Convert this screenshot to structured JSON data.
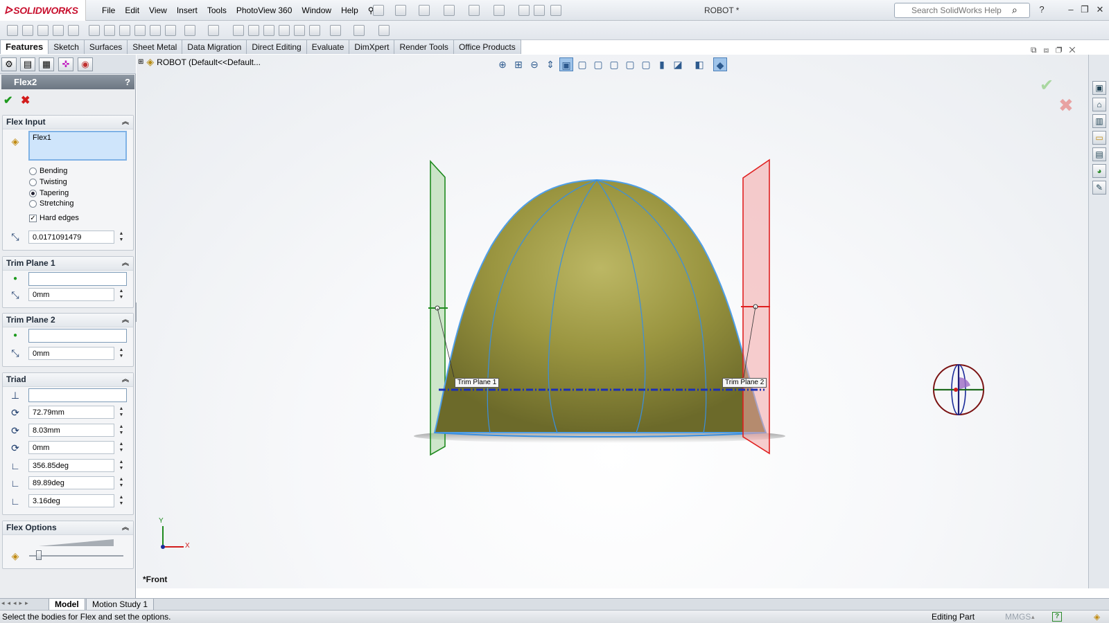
{
  "app": {
    "logo": "SOLIDWORKS",
    "doc_title": "ROBOT *"
  },
  "menu": [
    "File",
    "Edit",
    "View",
    "Insert",
    "Tools",
    "PhotoView 360",
    "Window",
    "Help"
  ],
  "search": {
    "placeholder": "Search SolidWorks Help"
  },
  "command_tabs": [
    "Features",
    "Sketch",
    "Surfaces",
    "Sheet Metal",
    "Data Migration",
    "Direct Editing",
    "Evaluate",
    "DimXpert",
    "Render Tools",
    "Office Products"
  ],
  "property_manager": {
    "title": "Flex2",
    "help": "?",
    "flex_input": {
      "heading": "Flex Input",
      "selection": "Flex1",
      "modes": [
        {
          "label": "Bending",
          "selected": false
        },
        {
          "label": "Twisting",
          "selected": false
        },
        {
          "label": "Tapering",
          "selected": true
        },
        {
          "label": "Stretching",
          "selected": false
        }
      ],
      "hard_edges_label": "Hard edges",
      "hard_edges_checked": true,
      "taper_factor": "0.0171091479"
    },
    "trim_plane_1": {
      "heading": "Trim Plane 1",
      "selection": "",
      "distance": "0mm"
    },
    "trim_plane_2": {
      "heading": "Trim Plane 2",
      "selection": "",
      "distance": "0mm"
    },
    "triad": {
      "heading": "Triad",
      "selection": "",
      "x": "72.79mm",
      "y": "8.03mm",
      "z": "0mm",
      "rot_x": "356.85deg",
      "rot_y": "89.89deg",
      "rot_z": "3.16deg"
    },
    "flex_options": {
      "heading": "Flex Options",
      "accuracy_level": 0.1
    }
  },
  "viewport": {
    "tree_root": "ROBOT  (Default<<Default...",
    "trim_label_1": "Trim Plane 1",
    "trim_label_2": "Trim Plane 2",
    "view_name": "*Front",
    "axis_x": "X",
    "axis_y": "Y",
    "colors": {
      "body": "#8f8f3a",
      "edge": "#3a8fe0",
      "trim1": "#1e8a1e",
      "trim2": "#e02020"
    }
  },
  "bottom_tabs": [
    "Model",
    "Motion Study 1"
  ],
  "status": {
    "message": "Select the bodies for Flex and set the options.",
    "mode": "Editing Part",
    "units": "MMGS"
  }
}
